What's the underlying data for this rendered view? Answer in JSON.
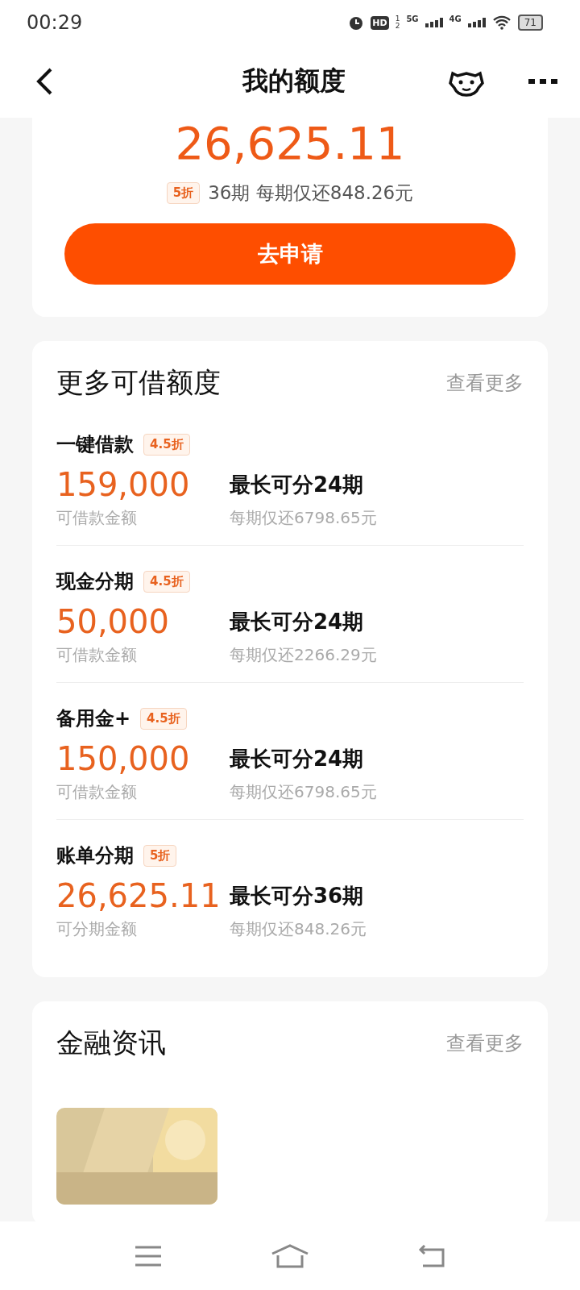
{
  "status_bar": {
    "time": "00:29",
    "hd": "HD",
    "hd_slots": [
      "1",
      "2"
    ],
    "networks": [
      "5G",
      "4G"
    ],
    "battery": "71"
  },
  "nav": {
    "title": "我的额度"
  },
  "top_card": {
    "amount": "26,625.11",
    "tag": "5折",
    "summary": "36期 每期仅还848.26元",
    "button": "去申请"
  },
  "more_section": {
    "title": "更多可借额度",
    "more": "查看更多",
    "items": [
      {
        "name": "一键借款",
        "tag": "4.5折",
        "amount": "159,000",
        "amount_label": "可借款金额",
        "term": "最长可分24期",
        "installment": "每期仅还6798.65元"
      },
      {
        "name": "现金分期",
        "tag": "4.5折",
        "amount": "50,000",
        "amount_label": "可借款金额",
        "term": "最长可分24期",
        "installment": "每期仅还2266.29元"
      },
      {
        "name": "备用金+",
        "tag": "4.5折",
        "amount": "150,000",
        "amount_label": "可借款金额",
        "term": "最长可分24期",
        "installment": "每期仅还6798.65元"
      },
      {
        "name": "账单分期",
        "tag": "5折",
        "amount": "26,625.11",
        "amount_label": "可分期金额",
        "term": "最长可分36期",
        "installment": "每期仅还848.26元"
      }
    ]
  },
  "news_section": {
    "title": "金融资讯",
    "more": "查看更多"
  }
}
